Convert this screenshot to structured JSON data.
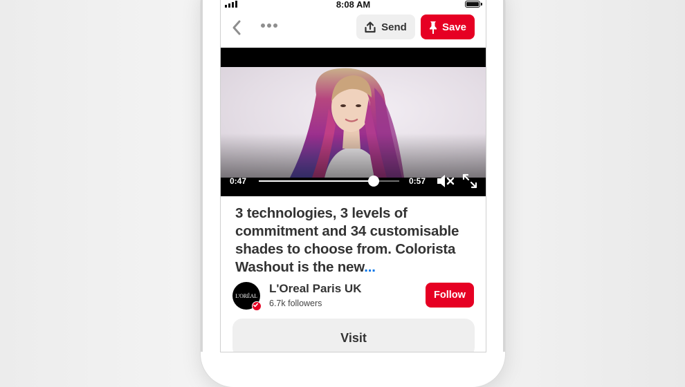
{
  "status_bar": {
    "time": "8:08 AM"
  },
  "top_bar": {
    "send_label": "Send",
    "save_label": "Save"
  },
  "video": {
    "current_time": "0:47",
    "total_time": "0:57",
    "progress_fraction": 0.82,
    "muted": true
  },
  "pin": {
    "description": "3 technologies, 3 levels of commitment and 34 customisable shades to choose from. Colorista Washout is the new",
    "ellipsis": "..."
  },
  "creator": {
    "logo_text": "L'ORÉAL",
    "name": "L'Oreal Paris UK",
    "followers": "6.7k followers",
    "follow_label": "Follow",
    "verified": true
  },
  "visit_label": "Visit",
  "colors": {
    "brand_red": "#e60023",
    "button_gray": "#efefef",
    "link_blue": "#0074e8"
  },
  "icons": [
    "back-chevron-icon",
    "more-dots-icon",
    "share-upload-icon",
    "pushpin-icon",
    "volume-muted-icon",
    "fullscreen-expand-icon",
    "verified-check-icon"
  ]
}
